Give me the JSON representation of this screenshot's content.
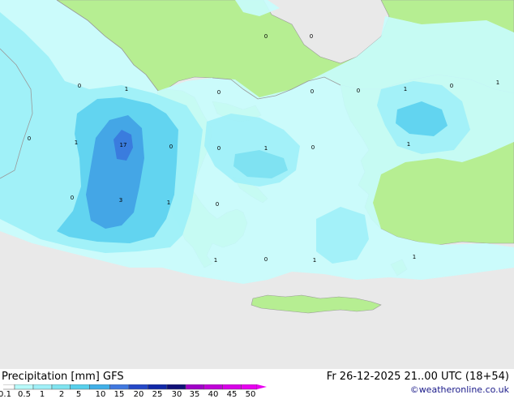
{
  "map": {
    "point_labels": [
      "0",
      "0",
      "0",
      "1",
      "0",
      "0",
      "0",
      "1",
      "0",
      "1",
      "17",
      "0",
      "0",
      "1",
      "0",
      "1",
      "1",
      "0",
      "3",
      "1",
      "0",
      "0",
      "1",
      "0",
      "1",
      "1"
    ],
    "colors": {
      "sea_dry": "#e9e9e9",
      "land": "#b6ee92",
      "coast": "#9a9a9a"
    }
  },
  "footer": {
    "title": "Precipitation [mm] GFS",
    "valid": "Fr 26-12-2025 21..00 UTC (18+54)",
    "credit": "©weatheronline.co.uk"
  },
  "legend": {
    "ticks": [
      "0.1",
      "0.5",
      "1",
      "2",
      "5",
      "10",
      "15",
      "20",
      "25",
      "30",
      "35",
      "40",
      "45",
      "50"
    ],
    "colors": [
      "#ffffff",
      "#b8fafa",
      "#a0f0f8",
      "#80e4f0",
      "#58d0ec",
      "#40b0e8",
      "#4078e0",
      "#2448c8",
      "#1028a8",
      "#101078",
      "#a000c8",
      "#c000d8",
      "#d800e8",
      "#e800f0"
    ]
  }
}
